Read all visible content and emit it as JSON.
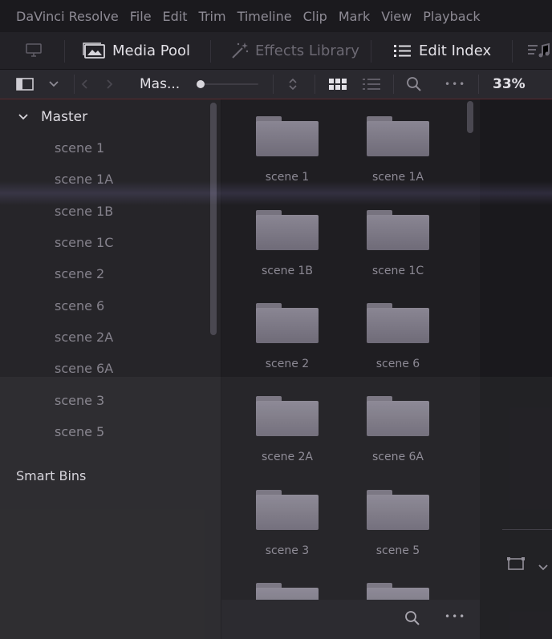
{
  "menu": [
    "DaVinci Resolve",
    "File",
    "Edit",
    "Trim",
    "Timeline",
    "Clip",
    "Mark",
    "View",
    "Playback"
  ],
  "toolbar": {
    "media_pool": "Media Pool",
    "effects_library": "Effects Library",
    "edit_index": "Edit Index"
  },
  "subbar": {
    "bin_path": "Mas...",
    "zoom": "33%",
    "more": "•••"
  },
  "bins": {
    "master": "Master",
    "items": [
      "scene 1",
      "scene 1A",
      "scene 1B",
      "scene 1C",
      "scene 2",
      "scene 6",
      "scene 2A",
      "scene 6A",
      "scene 3",
      "scene 5"
    ],
    "smart_bins": "Smart Bins"
  },
  "grid": {
    "folders": [
      "scene 1",
      "scene 1A",
      "scene 1B",
      "scene 1C",
      "scene 2",
      "scene 6",
      "scene 2A",
      "scene 6A",
      "scene 3",
      "scene 5"
    ]
  },
  "bottom": {
    "more": "•••"
  }
}
